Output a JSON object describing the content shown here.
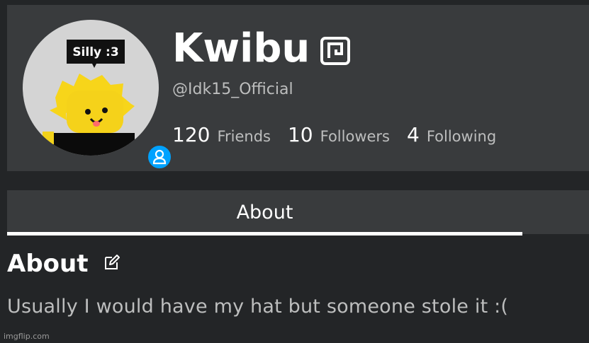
{
  "profile": {
    "display_name": "Kwibu",
    "username": "@Idk15_Official",
    "avatar_caption": "Silly :3",
    "stats": [
      {
        "count": "120",
        "label": "Friends"
      },
      {
        "count": "10",
        "label": "Followers"
      },
      {
        "count": "4",
        "label": "Following"
      }
    ]
  },
  "tabs": [
    {
      "label": "About",
      "active": true
    }
  ],
  "about": {
    "heading": "About",
    "text": "Usually I would have my hat but someone stole it :("
  },
  "watermark": "imgflip.com",
  "colors": {
    "background": "#232527",
    "card": "#393b3d",
    "status_blue": "#00a2ff",
    "muted_text": "#bdbebe"
  },
  "icons": {
    "premium": "premium-icon",
    "status": "user-status-icon",
    "edit": "edit-icon"
  }
}
